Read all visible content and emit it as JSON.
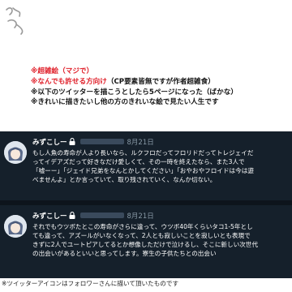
{
  "warnings": [
    {
      "text": "※超雑絵（マジで）",
      "color": "#e0212b"
    },
    {
      "text": "※なんでも許せる方向け",
      "color": "#e0212b",
      "suffix": "（CP要素皆無ですが作者超雑食）"
    },
    {
      "text": "※以下のツイッターを描こうとしたら5ページになった（ばかな）",
      "color": "#141414"
    },
    {
      "text": "※きれいに描きたいし他の方のきれいな絵で見たい人生です",
      "color": "#141414"
    }
  ],
  "tweets": [
    {
      "name": "みずこしー",
      "date": "8月21日",
      "lines": [
        "もし人魚の寿命が人より長いなら、ルクフロだってフロリドだってトレジェイだ",
        "ってイデアズだって好きなだけ愛しくて、その一時を終えたなら、また3人で",
        "「嘘ーー」「ジェイド兄弟をなんとかしてください」「おやおやフロイドは今は遊",
        "べませんよ」とか言っていて、取り残されていく、なんか切ない。"
      ]
    },
    {
      "name": "みずこしー",
      "date": "8月21日",
      "lines": [
        "それでもウツボたとこの寿命がさらに違って、ウツボ40年くらいタコ1-5年とし",
        "ても違って、アズールがいなくなって、2人とも寂しいことを寂しいとも表現で",
        "きずに2人でユートピアしてるとか想像しただけで泣けるし、そこに新しい次世代",
        "の出会いがあるといいと思ってします。寮生の子供たちとの出会い"
      ]
    }
  ],
  "caption": "※ツイッターアイコンはフォロワーさんに描いて頂いたものです"
}
